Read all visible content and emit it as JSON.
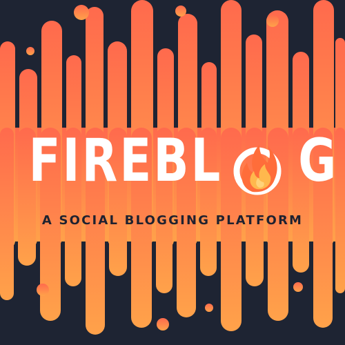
{
  "brand": {
    "title_left": "FIREBL",
    "title_right": "G",
    "tagline": "A SOCIAL BLOGGING PLATFORM",
    "logo_icon": "flame-icon"
  },
  "colors": {
    "background": "#1e2433",
    "gradient_top": "#ff6a4d",
    "gradient_bottom": "#ffa24a",
    "title": "#ffffff",
    "tagline": "#1f2230"
  }
}
